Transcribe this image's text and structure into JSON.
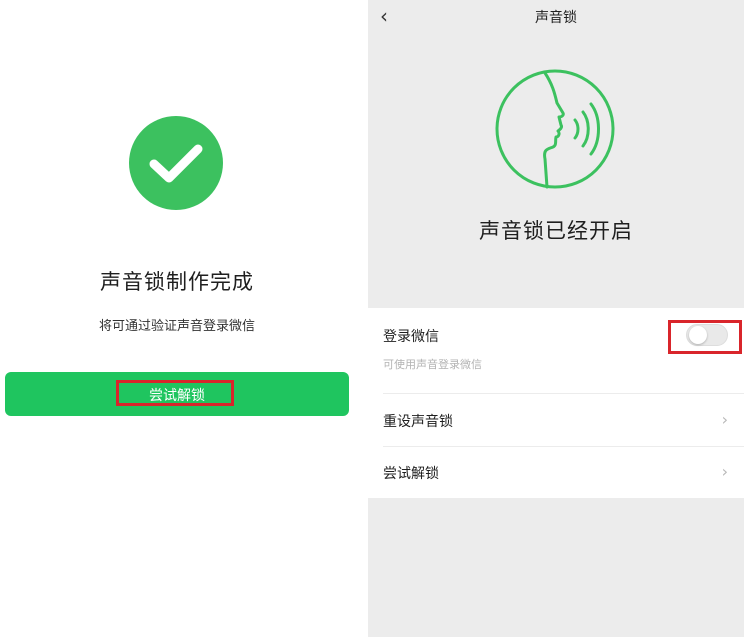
{
  "left_screen": {
    "title": "声音锁制作完成",
    "subtitle": "将可通过验证声音登录微信",
    "try_button_label": "尝试解锁"
  },
  "right_screen": {
    "nav_title": "声音锁",
    "back_icon": "‹",
    "status_text": "声音锁已经开启",
    "settings": {
      "login_label": "登录微信",
      "login_sub": "可使用声音登录微信",
      "login_toggle_on": false,
      "reset_label": "重设声音锁",
      "try_label": "尝试解锁",
      "chevron": "›"
    }
  },
  "colors": {
    "brand_green": "#1fc55f",
    "icon_green": "#3cc15f",
    "highlight_red": "#d9252b"
  },
  "icons": [
    "checkmark-icon",
    "back-icon",
    "voice-face-icon",
    "chevron-right-icon"
  ]
}
